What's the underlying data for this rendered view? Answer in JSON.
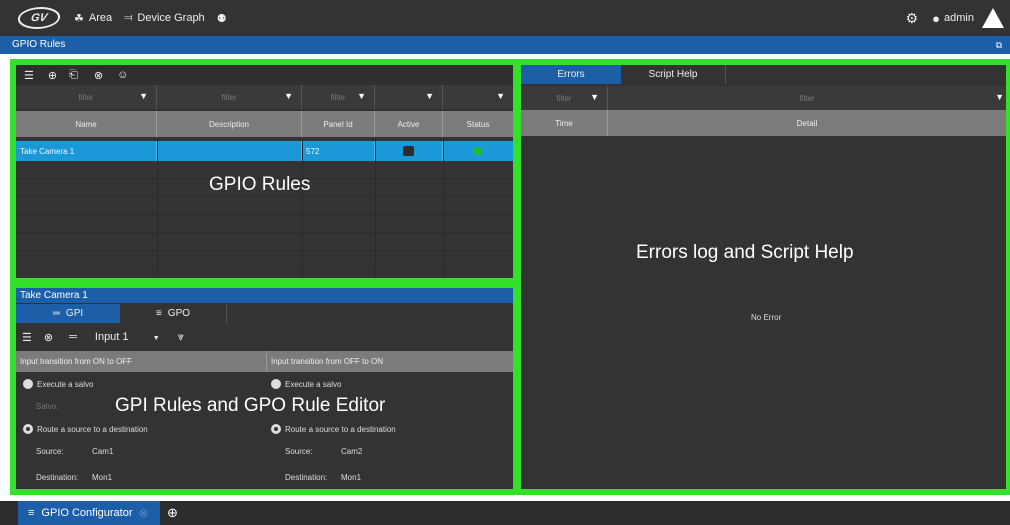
{
  "topbar": {
    "logo": "GV",
    "area_label": "Area",
    "device_graph_label": "Device Graph",
    "user_label": "admin"
  },
  "title": "GPIO Rules",
  "rules_table": {
    "filter_placeholder": "filter",
    "columns": [
      "Name",
      "Description",
      "Panel Id",
      "Active",
      "Status"
    ],
    "rows": [
      {
        "name": "Take Camera 1",
        "description": "",
        "panel_id": "572",
        "active": true,
        "status": "ok"
      }
    ]
  },
  "errors_panel": {
    "tabs": [
      "Errors",
      "Script Help"
    ],
    "filter_placeholder": "filter",
    "columns": [
      "Time",
      "Detail"
    ],
    "empty_message": "No Error"
  },
  "editor": {
    "rule_title": "Take Camera 1",
    "tabs": [
      "GPI",
      "GPO"
    ],
    "input_select": "Input 1",
    "left": {
      "header": "Input transition from ON to OFF",
      "execute_salvo": "Execute a salvo",
      "salvo_label": "Salvo:",
      "route_label": "Route a source to a destination",
      "source_label": "Source:",
      "source_value": "Cam1",
      "destination_label": "Destination:",
      "destination_value": "Mon1"
    },
    "right": {
      "header": "Input transition from OFF to ON",
      "execute_salvo": "Execute a salvo",
      "route_label": "Route a source to a destination",
      "source_label": "Source:",
      "source_value": "Cam2",
      "destination_label": "Destination:",
      "destination_value": "Mon1"
    }
  },
  "overlay_labels": {
    "rules": "GPIO Rules",
    "errors": "Errors log and Script Help",
    "editor": "GPI Rules and GPO Rule Editor"
  },
  "bottom_tab": {
    "label": "GPIO Configurator"
  },
  "colors": {
    "accent_blue": "#1c5ea8",
    "selection_blue": "#1a98d8",
    "highlight_green": "#33e12a",
    "status_green": "#17c617"
  }
}
